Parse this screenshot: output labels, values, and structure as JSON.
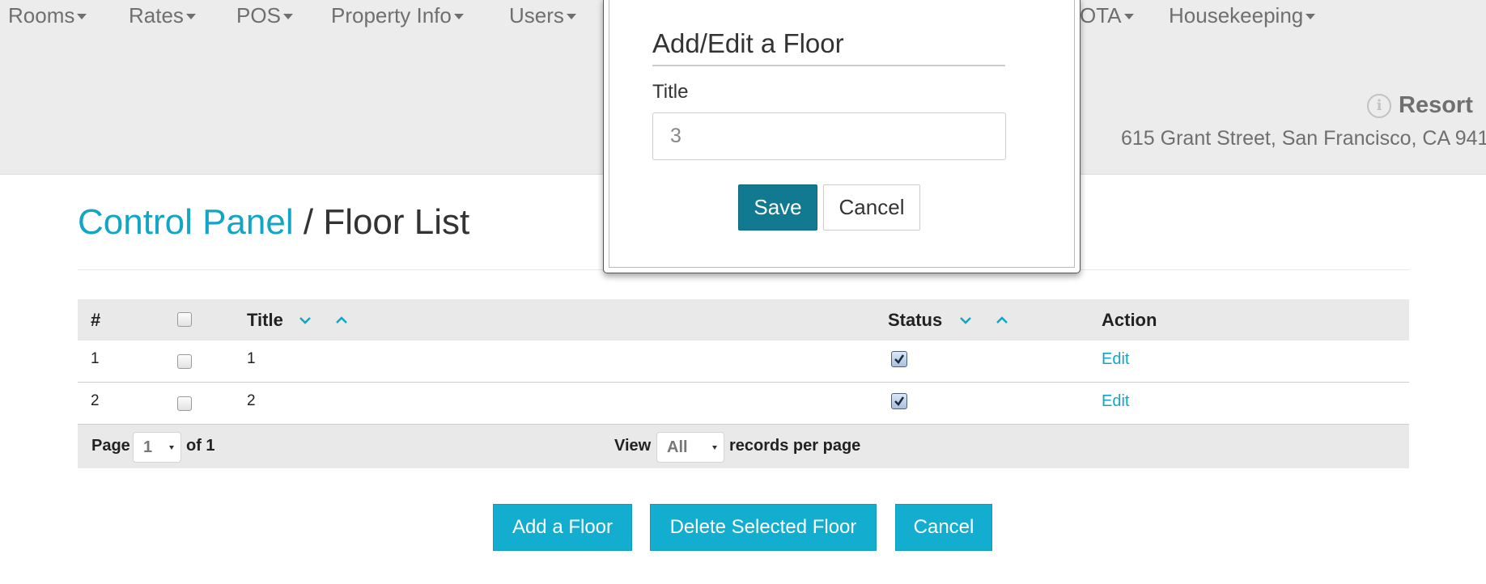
{
  "nav": {
    "items": [
      "Rooms",
      "Rates",
      "POS",
      "Property Info",
      "Users",
      "OTA",
      "Housekeeping"
    ]
  },
  "property": {
    "name": "Resort",
    "address": "615 Grant Street, San Francisco, CA 941"
  },
  "breadcrumb": {
    "parent": "Control Panel",
    "separator": "/",
    "current": "Floor List"
  },
  "table": {
    "headers": {
      "num": "#",
      "title": "Title",
      "status": "Status",
      "action": "Action"
    },
    "rows": [
      {
        "num": "1",
        "title": "1",
        "status_checked": true,
        "action": "Edit"
      },
      {
        "num": "2",
        "title": "2",
        "status_checked": true,
        "action": "Edit"
      }
    ],
    "footer": {
      "page_label": "Page",
      "page_value": "1",
      "of_label": "of 1",
      "view_label": "View",
      "view_value": "All",
      "per_page_label": "records per page"
    }
  },
  "buttons": {
    "add": "Add a Floor",
    "delete": "Delete Selected Floor",
    "cancel": "Cancel"
  },
  "modal": {
    "title": "Add/Edit a Floor",
    "field_label": "Title",
    "field_value": "3",
    "save": "Save",
    "cancel": "Cancel"
  },
  "colors": {
    "accent": "#13add0",
    "save_button": "#117a91",
    "header_bg": "#ececec"
  }
}
